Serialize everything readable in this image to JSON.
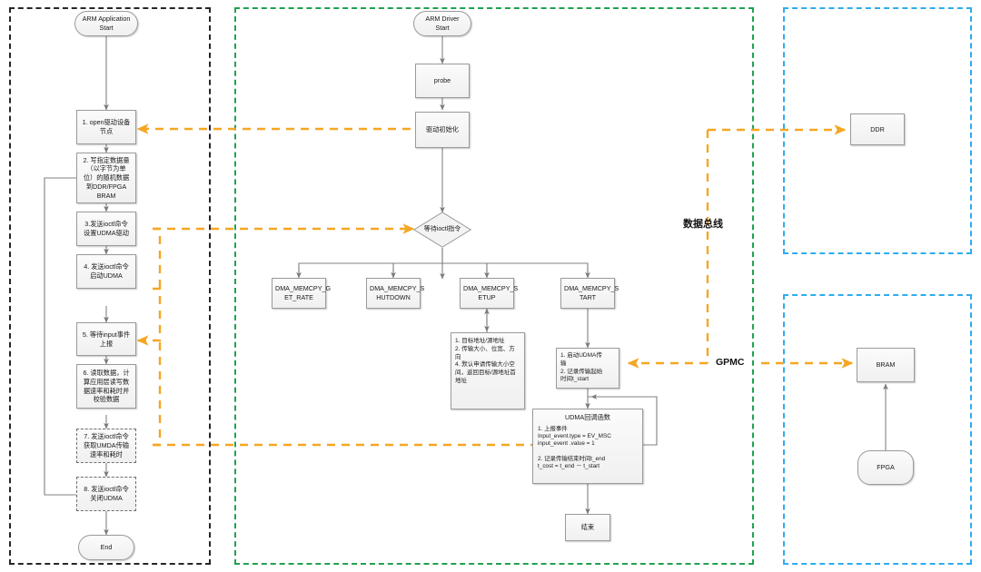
{
  "diagram": {
    "title": "ARM Application / ARM Driver UDMA transfer flowchart",
    "colors": {
      "app_group_border": "#262626",
      "driver_group_border": "#21a150",
      "hw_group_border": "#2eacf0",
      "signal_arrow": "#f5a623",
      "flow_arrow": "#808080",
      "node_fill": "#f3f3f3",
      "node_border": "#9a9a9a"
    },
    "groups": [
      {
        "id": "app",
        "name": "application-group",
        "style": "black"
      },
      {
        "id": "driver",
        "name": "driver-group",
        "style": "green"
      },
      {
        "id": "ddr",
        "name": "ddr-hardware-group",
        "style": "blue"
      },
      {
        "id": "bram",
        "name": "bram-hardware-group",
        "style": "blue"
      }
    ],
    "bus_labels": [
      {
        "id": "data_bus",
        "text": "数据总线"
      },
      {
        "id": "gpmc",
        "text": "GPMC"
      }
    ],
    "app_nodes": {
      "start": "ARM Application\nStart",
      "step1": "1. open驱动设备\n节点",
      "step2": "2. 写指定数据量\n（以字节为单\n位）的随机数据\n到DDR/FPGA\nBRAM",
      "step3": "3.发送ioctl命令\n设置UDMA驱动",
      "step4": "4. 发送ioctl命令\n启动UDMA",
      "step5": "5. 等待input事件\n上报",
      "step6": "6. 读取数据，计\n算应用层读写数\n据速率和耗时并\n校验数据",
      "step7": "7. 发送ioctl命令\n获取UMDA传输\n速率和耗时",
      "step8": "8. 发送ioctl命令\n关闭UDMA",
      "end": "End"
    },
    "driver_nodes": {
      "start": "ARM Driver\nStart",
      "probe": "probe",
      "init": "驱动初始化",
      "wait": "等待ioctl指令",
      "cmd_get_rate": "DMA_MEMCPY_G\nET_RATE",
      "cmd_shutdown": "DMA_MEMCPY_S\nHUTDOWN",
      "cmd_setup": "DMA_MEMCPY_S\nETUP",
      "cmd_start": "DMA_MEMCPY_S\nTART",
      "setup_detail": "1. 目标地址/源地址\n2. 传输大小、位宽、方向\n4. 默认申请传输大小空\n间，返回目标/源地址首\n地址",
      "start_detail": "1. 启动UDMA传\n输\n2. 记录传输起始\n时间t_start",
      "callback_title": "UDMA回调函数",
      "callback_body": "1. 上报事件\nInput_event.type = EV_MSC\ninput_event .value = 1\n\n2. 记录传输结束时间t_end\nt_cost = t_end － t_start",
      "finish": "结束"
    },
    "hw_nodes": {
      "ddr": "DDR",
      "bram": "BRAM",
      "fpga": "FPGA"
    }
  }
}
